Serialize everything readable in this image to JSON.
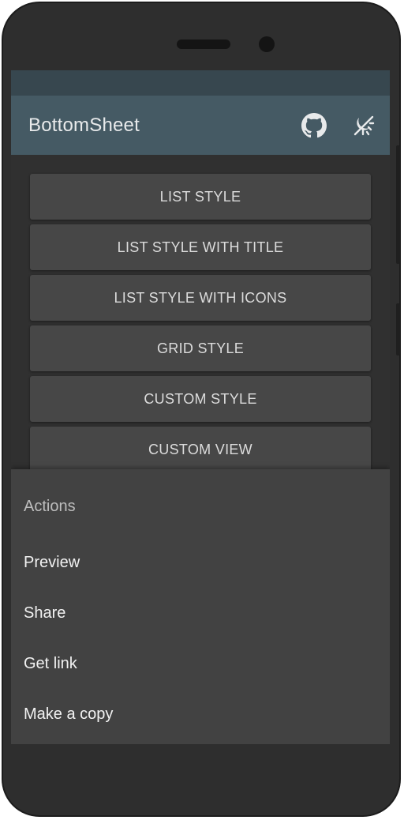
{
  "appbar": {
    "title": "BottomSheet",
    "icons": [
      "github-icon",
      "theme-toggle-icon"
    ],
    "color": "#455a64",
    "statusbar_color": "#37474f"
  },
  "buttons": [
    {
      "label": "LIST STYLE"
    },
    {
      "label": "LIST STYLE WITH TITLE"
    },
    {
      "label": "LIST STYLE WITH ICONS"
    },
    {
      "label": "GRID STYLE"
    },
    {
      "label": "CUSTOM STYLE"
    },
    {
      "label": "CUSTOM VIEW"
    }
  ],
  "bottom_sheet": {
    "title": "Actions",
    "items": [
      {
        "label": "Preview"
      },
      {
        "label": "Share"
      },
      {
        "label": "Get link"
      },
      {
        "label": "Make a copy"
      }
    ],
    "background": "#424242"
  }
}
